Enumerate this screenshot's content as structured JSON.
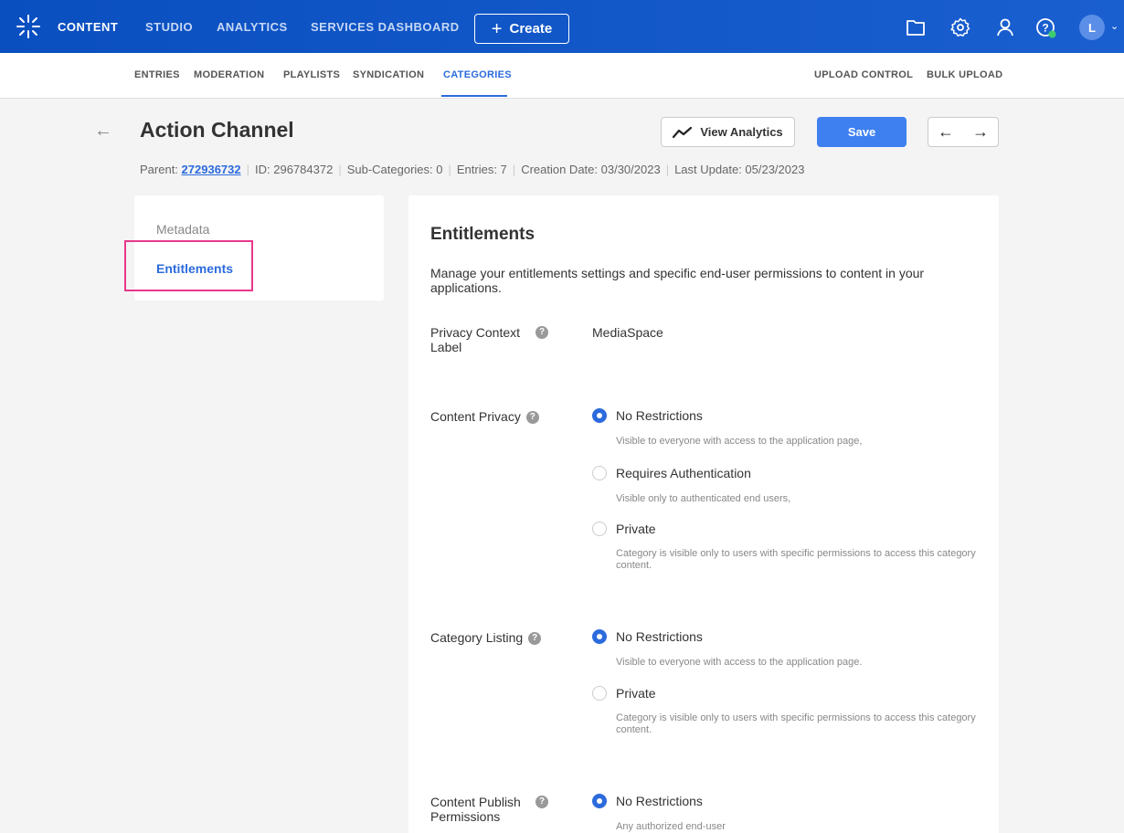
{
  "topnav": {
    "items": [
      {
        "label": "CONTENT"
      },
      {
        "label": "STUDIO"
      },
      {
        "label": "ANALYTICS"
      },
      {
        "label": "SERVICES DASHBOARD"
      }
    ],
    "create_label": "Create",
    "avatar_initial": "L"
  },
  "subnav": {
    "left": [
      {
        "label": "ENTRIES"
      },
      {
        "label": "MODERATION"
      },
      {
        "label": "PLAYLISTS"
      },
      {
        "label": "SYNDICATION"
      },
      {
        "label": "CATEGORIES"
      }
    ],
    "right": [
      {
        "label": "UPLOAD CONTROL"
      },
      {
        "label": "BULK UPLOAD"
      }
    ]
  },
  "header": {
    "title": "Action Channel",
    "view_analytics_label": "View Analytics",
    "save_label": "Save",
    "parent_label": "Parent:",
    "parent_id": "272936732",
    "id": "ID: 296784372",
    "subcategories": "Sub-Categories: 0",
    "entries": "Entries: 7",
    "created": "Creation Date: 03/30/2023",
    "updated": "Last Update: 05/23/2023"
  },
  "sidebar": {
    "items": [
      {
        "label": "Metadata"
      },
      {
        "label": "Entitlements"
      }
    ]
  },
  "entitlements": {
    "title": "Entitlements",
    "description": "Manage your entitlements settings and specific end-user permissions to content in your applications.",
    "privacy_context": {
      "label": "Privacy Context Label",
      "value": "MediaSpace"
    },
    "content_privacy": {
      "label": "Content Privacy",
      "options": [
        {
          "label": "No Restrictions",
          "desc": "Visible to everyone with access to the application page,",
          "selected": true
        },
        {
          "label": "Requires Authentication",
          "desc": "Visible only to authenticated end users,",
          "selected": false
        },
        {
          "label": "Private",
          "desc": "Category is visible only to users with specific permissions to access this category content.",
          "selected": false
        }
      ]
    },
    "category_listing": {
      "label": "Category Listing",
      "options": [
        {
          "label": "No Restrictions",
          "desc": "Visible to everyone with access to the application page.",
          "selected": true
        },
        {
          "label": "Private",
          "desc": "Category is visible only to users with specific permissions to access this category content.",
          "selected": false
        }
      ]
    },
    "content_publish": {
      "label": "Content Publish Permissions",
      "options": [
        {
          "label": "No Restrictions",
          "desc": "Any authorized end-user",
          "selected": true
        }
      ]
    }
  },
  "colors": {
    "brand_blue": "#2c6bdd",
    "topbar": "#1a5fd0",
    "highlight": "#e8388a"
  },
  "icons": [
    "logo-icon",
    "folder-icon",
    "gear-icon",
    "user-icon",
    "help-icon",
    "back-arrow-icon",
    "analytics-icon",
    "arrow-left-icon",
    "arrow-right-icon"
  ]
}
